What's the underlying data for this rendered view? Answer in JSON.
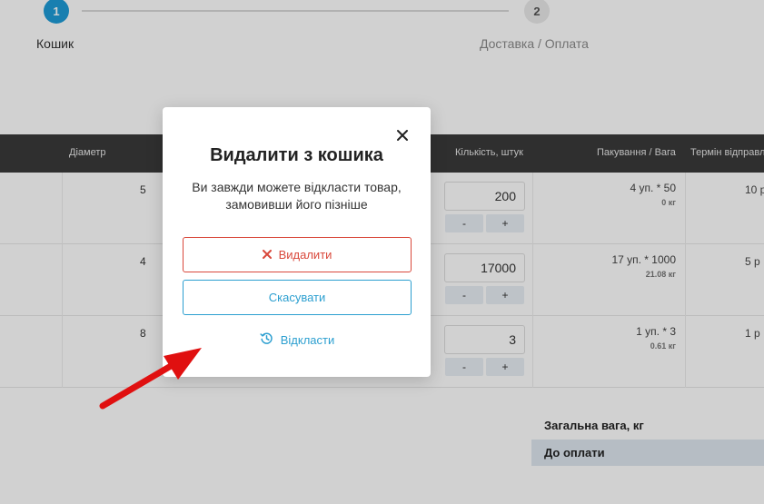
{
  "stepper": {
    "steps": [
      {
        "number": "1",
        "label": "Кошик"
      },
      {
        "number": "2",
        "label": "Доставка / Оплата"
      }
    ]
  },
  "table": {
    "headers": {
      "diameter": "Діаметр",
      "quantity": "Кількість, штук",
      "packing": "Пакування / Вага",
      "term": "Термін відправл"
    },
    "rows": [
      {
        "diameter": "5",
        "quantity": "200",
        "packing": "4 уп. * 50",
        "weight": "0 кг",
        "term": "10 р",
        "minus": "-",
        "plus": "+"
      },
      {
        "diameter": "4",
        "quantity": "17000",
        "packing": "17 уп. * 1000",
        "weight": "21.08 кг",
        "term": "5 р",
        "minus": "-",
        "plus": "+"
      },
      {
        "diameter": "8",
        "quantity": "3",
        "packing": "1 уп. * 3",
        "weight": "0.61 кг",
        "term": "1 р",
        "minus": "-",
        "plus": "+"
      }
    ]
  },
  "summary": {
    "total_weight_label": "Загальна вага, кг",
    "to_pay_label": "До оплати"
  },
  "modal": {
    "title": "Видалити з кошика",
    "text": "Ви завжди можете відкласти товар, замовивши його пізніше",
    "delete_label": "Видалити",
    "cancel_label": "Скасувати",
    "postpone_label": "Відкласти"
  },
  "colors": {
    "accent": "#1e9cd7",
    "delete": "#d9483b",
    "link": "#2c9fd0",
    "arrow": "#e01010"
  },
  "icons": {
    "close": "close-icon",
    "delete": "x-icon",
    "postpone": "clock-history-icon"
  }
}
